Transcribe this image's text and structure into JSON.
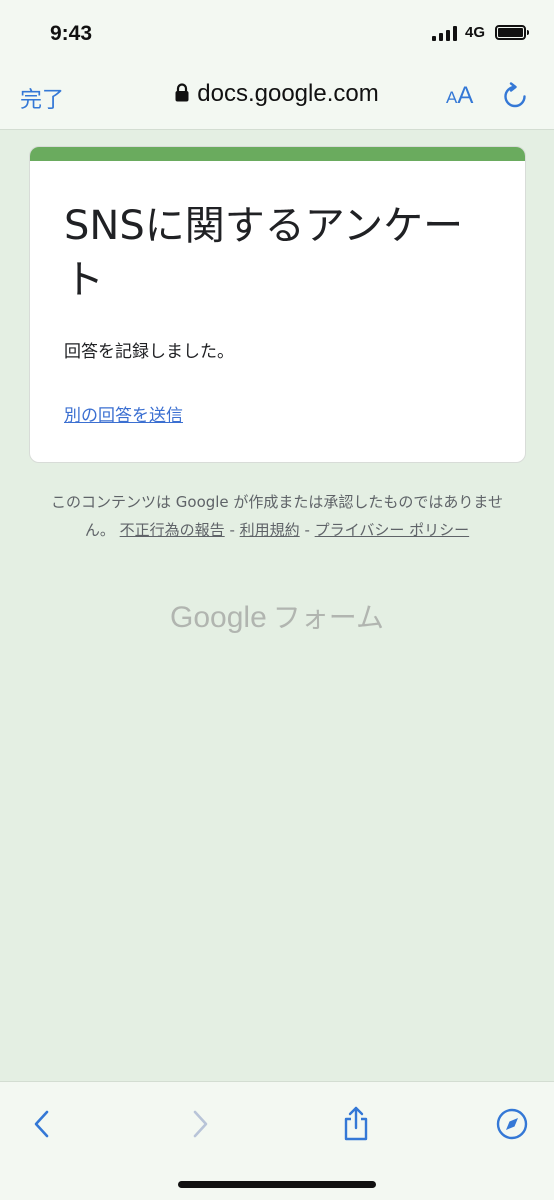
{
  "status": {
    "time": "9:43",
    "network": "4G"
  },
  "browser": {
    "done_label": "完了",
    "url": "docs.google.com",
    "text_size_small": "A",
    "text_size_large": "A",
    "accent_color": "#3478d6"
  },
  "form": {
    "title": "SNSに関するアンケート",
    "message": "回答を記録しました。",
    "resubmit_link": "別の回答を送信",
    "accent_color": "#6aab5e"
  },
  "footer": {
    "disclaimer": "このコンテンツは Google が作成または承認したものではありません。",
    "report_abuse": "不正行為の報告",
    "separator": "-",
    "terms": "利用規約",
    "privacy": "プライバシー ポリシー",
    "brand_google": "Google",
    "brand_forms": "フォーム"
  },
  "toolbar": {
    "icons": [
      "back-icon",
      "forward-icon",
      "share-icon",
      "compass-icon"
    ]
  }
}
